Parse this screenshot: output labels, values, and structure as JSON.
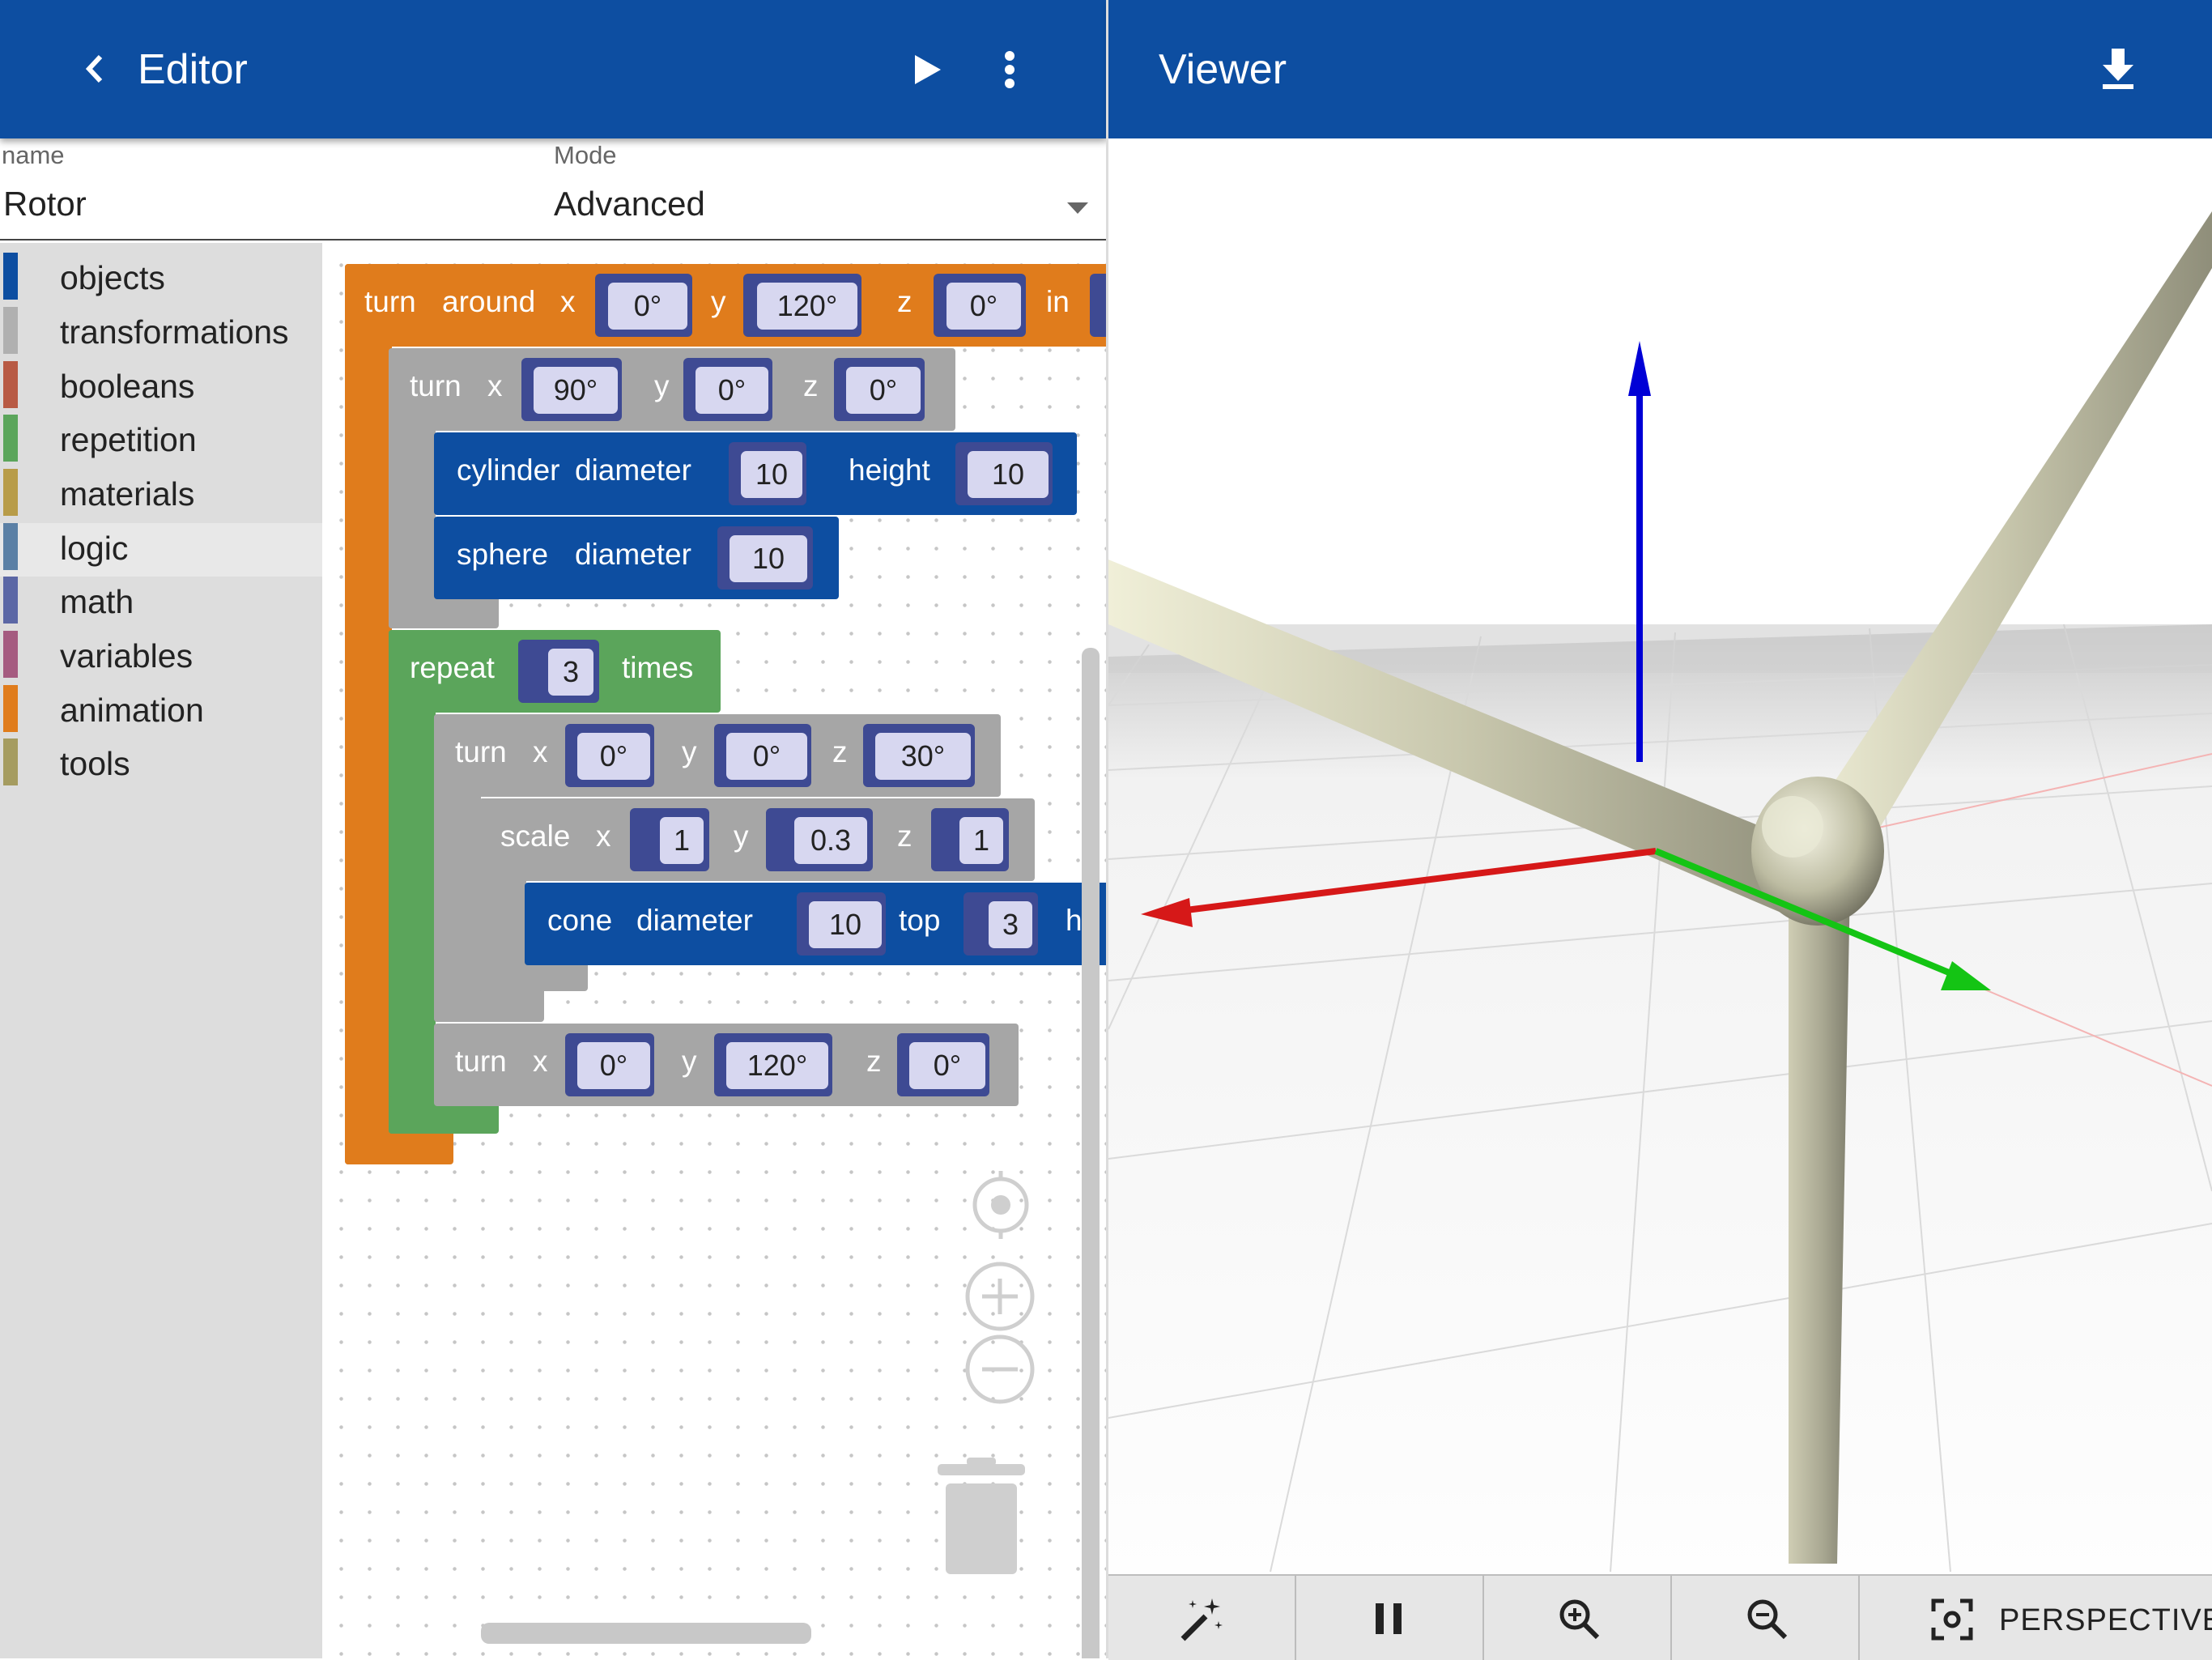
{
  "editor": {
    "title": "Editor",
    "back_icon": "chevron-left-icon",
    "run_icon": "play-icon",
    "menu_icon": "more-vert-icon"
  },
  "viewer": {
    "title": "Viewer",
    "download_icon": "download-icon"
  },
  "form": {
    "name_label": "name",
    "name_value": "Rotor",
    "mode_label": "Mode",
    "mode_value": "Advanced"
  },
  "toolbox": {
    "categories": [
      {
        "label": "objects",
        "color": "#0d4ea1"
      },
      {
        "label": "transformations",
        "color": "#b0b0b0"
      },
      {
        "label": "booleans",
        "color": "#b85a44"
      },
      {
        "label": "repetition",
        "color": "#5ba55b"
      },
      {
        "label": "materials",
        "color": "#b89c48"
      },
      {
        "label": "logic",
        "color": "#5b80a5"
      },
      {
        "label": "math",
        "color": "#5b67a5"
      },
      {
        "label": "variables",
        "color": "#a55b80"
      },
      {
        "label": "animation",
        "color": "#e07c1c"
      },
      {
        "label": "tools",
        "color": "#a59c60"
      }
    ],
    "selected": "logic"
  },
  "blocks": {
    "turn_around": {
      "kw": "turn",
      "kw2": "around",
      "x": "x",
      "y": "y",
      "z": "z",
      "in": "in",
      "xv": "0°",
      "yv": "120°",
      "zv": "0°"
    },
    "turn1": {
      "kw": "turn",
      "x": "x",
      "y": "y",
      "z": "z",
      "xv": "90°",
      "yv": "0°",
      "zv": "0°"
    },
    "cylinder": {
      "kw": "cylinder",
      "diameter": "diameter",
      "dv": "10",
      "height": "height",
      "hv": "10"
    },
    "sphere": {
      "kw": "sphere",
      "diameter": "diameter",
      "dv": "10"
    },
    "repeat": {
      "kw": "repeat",
      "count": "3",
      "times": "times"
    },
    "turn2": {
      "kw": "turn",
      "x": "x",
      "y": "y",
      "z": "z",
      "xv": "0°",
      "yv": "0°",
      "zv": "30°"
    },
    "scale": {
      "kw": "scale",
      "x": "x",
      "y": "y",
      "z": "z",
      "xv": "1",
      "yv": "0.3",
      "zv": "1"
    },
    "cone": {
      "kw": "cone",
      "diameter": "diameter",
      "dv": "10",
      "top": "top",
      "tv": "3",
      "cut": "h"
    },
    "turn3": {
      "kw": "turn",
      "x": "x",
      "y": "y",
      "z": "z",
      "xv": "0°",
      "yv": "120°",
      "zv": "0°"
    }
  },
  "colors": {
    "appbar": "#0d4ea1",
    "objects": "#0d4ea1",
    "transform": "#a6a6a6",
    "repetition": "#5ba55b",
    "animation": "#e07c1c",
    "value": "#d7d7f0"
  },
  "viewer_toolbar": {
    "wand_icon": "magic-wand-icon",
    "pause_icon": "pause-icon",
    "zoom_in_icon": "zoom-in-icon",
    "zoom_out_icon": "zoom-out-icon",
    "camera_icon": "center-focus-icon",
    "projection_label": "PERSPECTIVE"
  }
}
